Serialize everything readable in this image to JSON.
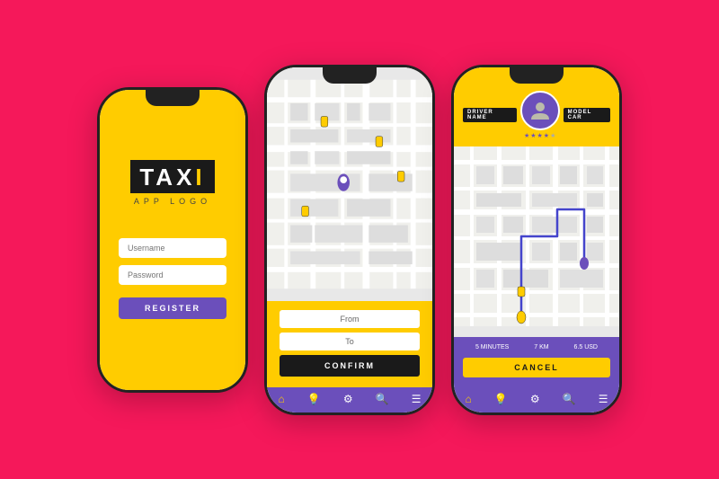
{
  "background_color": "#F5185A",
  "phone1": {
    "logo": {
      "taxi": "TAX",
      "taxi_i": "I",
      "app_logo": "APP LOGO"
    },
    "fields": {
      "username_placeholder": "Username",
      "password_placeholder": "Password"
    },
    "register_btn": "REGISTER"
  },
  "phone2": {
    "bottom": {
      "from_label": "From",
      "to_label": "To",
      "confirm_btn": "CONFIRM"
    },
    "nav_items": [
      "home",
      "bulb",
      "gear",
      "search",
      "menu"
    ]
  },
  "phone3": {
    "driver_header": {
      "driver_name_label": "DRIVER NAME",
      "model_car_label": "MODEL CAR",
      "stars": [
        true,
        true,
        true,
        true,
        false
      ]
    },
    "trip_stats": {
      "time": "5 MINUTES",
      "distance": "7 KM",
      "cost": "6.5 USD"
    },
    "cancel_btn": "CANCEL",
    "nav_items": [
      "home",
      "bulb",
      "gear",
      "search",
      "menu"
    ]
  }
}
